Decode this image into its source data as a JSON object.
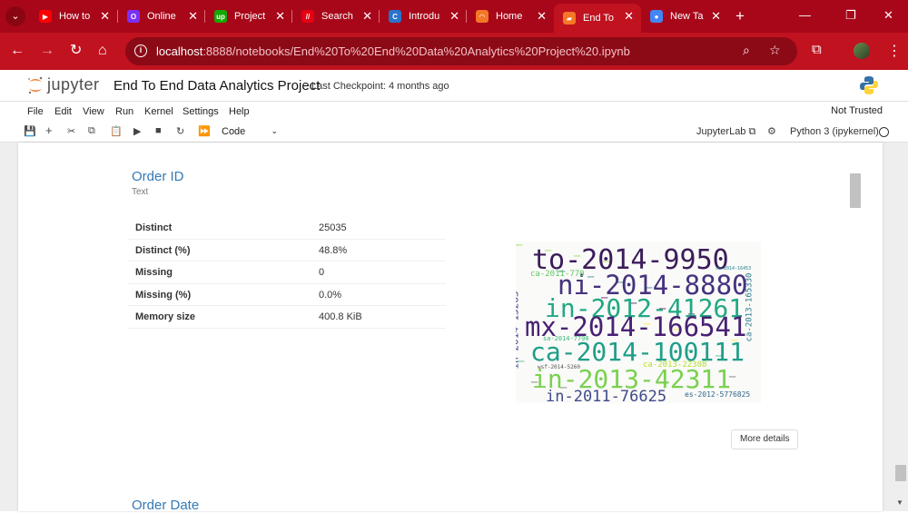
{
  "browser": {
    "tabs": [
      {
        "title": "How to",
        "icon": "youtube-icon",
        "color": "#ff0000",
        "glyph": "▶"
      },
      {
        "title": "Online",
        "icon": "online-app-icon",
        "color": "#7b2ff7",
        "glyph": "O"
      },
      {
        "title": "Project",
        "icon": "upwork-icon",
        "color": "#14a800",
        "glyph": "up"
      },
      {
        "title": "Search",
        "icon": "search-app-icon",
        "color": "#e60012",
        "glyph": "//"
      },
      {
        "title": "Introdu",
        "icon": "coursera-icon",
        "color": "#2a73cc",
        "glyph": "C"
      },
      {
        "title": "Home",
        "icon": "jupyter-tab-icon",
        "color": "#f37726",
        "glyph": "◠"
      },
      {
        "title": "End To",
        "icon": "jupyter-notebook-tab-icon",
        "color": "#f37726",
        "glyph": "▰"
      },
      {
        "title": "New Ta",
        "icon": "chrome-icon",
        "color": "#4285f4",
        "glyph": "●"
      }
    ],
    "active_tab": 6,
    "url_host": "localhost",
    "url_path": ":8888/notebooks/End%20To%20End%20Data%20Analytics%20Project%20.ipynb"
  },
  "jupyter": {
    "wordmark": "jupyter",
    "notebook_title": "End To End Data Analytics Project",
    "checkpoint": "Last Checkpoint: 4 months ago",
    "menu": [
      "File",
      "Edit",
      "View",
      "Run",
      "Kernel",
      "Settings",
      "Help"
    ],
    "trust_status": "Not Trusted",
    "cell_type": "Code",
    "jupyterlab_label": "JupyterLab",
    "kernel_name": "Python 3 (ipykernel)"
  },
  "profile_report": {
    "variable_name": "Order ID",
    "variable_type": "Text",
    "stats": [
      {
        "label": "Distinct",
        "value": "25035"
      },
      {
        "label": "Distinct (%)",
        "value": "48.8%"
      },
      {
        "label": "Missing",
        "value": "0"
      },
      {
        "label": "Missing (%)",
        "value": "0.0%"
      },
      {
        "label": "Memory size",
        "value": "400.8 KiB"
      }
    ],
    "wordcloud_words": [
      {
        "text": "to-2014-9950",
        "color": "#3b1c5a"
      },
      {
        "text": "ni-2014-8880",
        "color": "#46327e"
      },
      {
        "text": "in-2012-41261",
        "color": "#22a884"
      },
      {
        "text": "mx-2014-166541",
        "color": "#482173"
      },
      {
        "text": "ca-2014-100111",
        "color": "#1f9e89"
      },
      {
        "text": "in-2013-42311",
        "color": "#7ad151"
      },
      {
        "text": "in-2011-76625",
        "color": "#3e4a89"
      },
      {
        "text": "in-2014-15263",
        "color": "#414487"
      },
      {
        "text": "ca-2013-165330",
        "color": "#2a788e"
      },
      {
        "text": "es-2012-5776825",
        "color": "#31688e"
      },
      {
        "text": "ca-2011-770",
        "color": "#5ec962"
      },
      {
        "text": "wsf-2014-5260",
        "color": "#555555"
      },
      {
        "text": "ca-2014-16453",
        "color": "#26828e"
      },
      {
        "text": "ca-2013-22308",
        "color": "#b5de2b"
      },
      {
        "text": "sa-2014-7790",
        "color": "#35b779"
      }
    ],
    "more_details_label": "More details",
    "next_variable_name": "Order Date"
  }
}
